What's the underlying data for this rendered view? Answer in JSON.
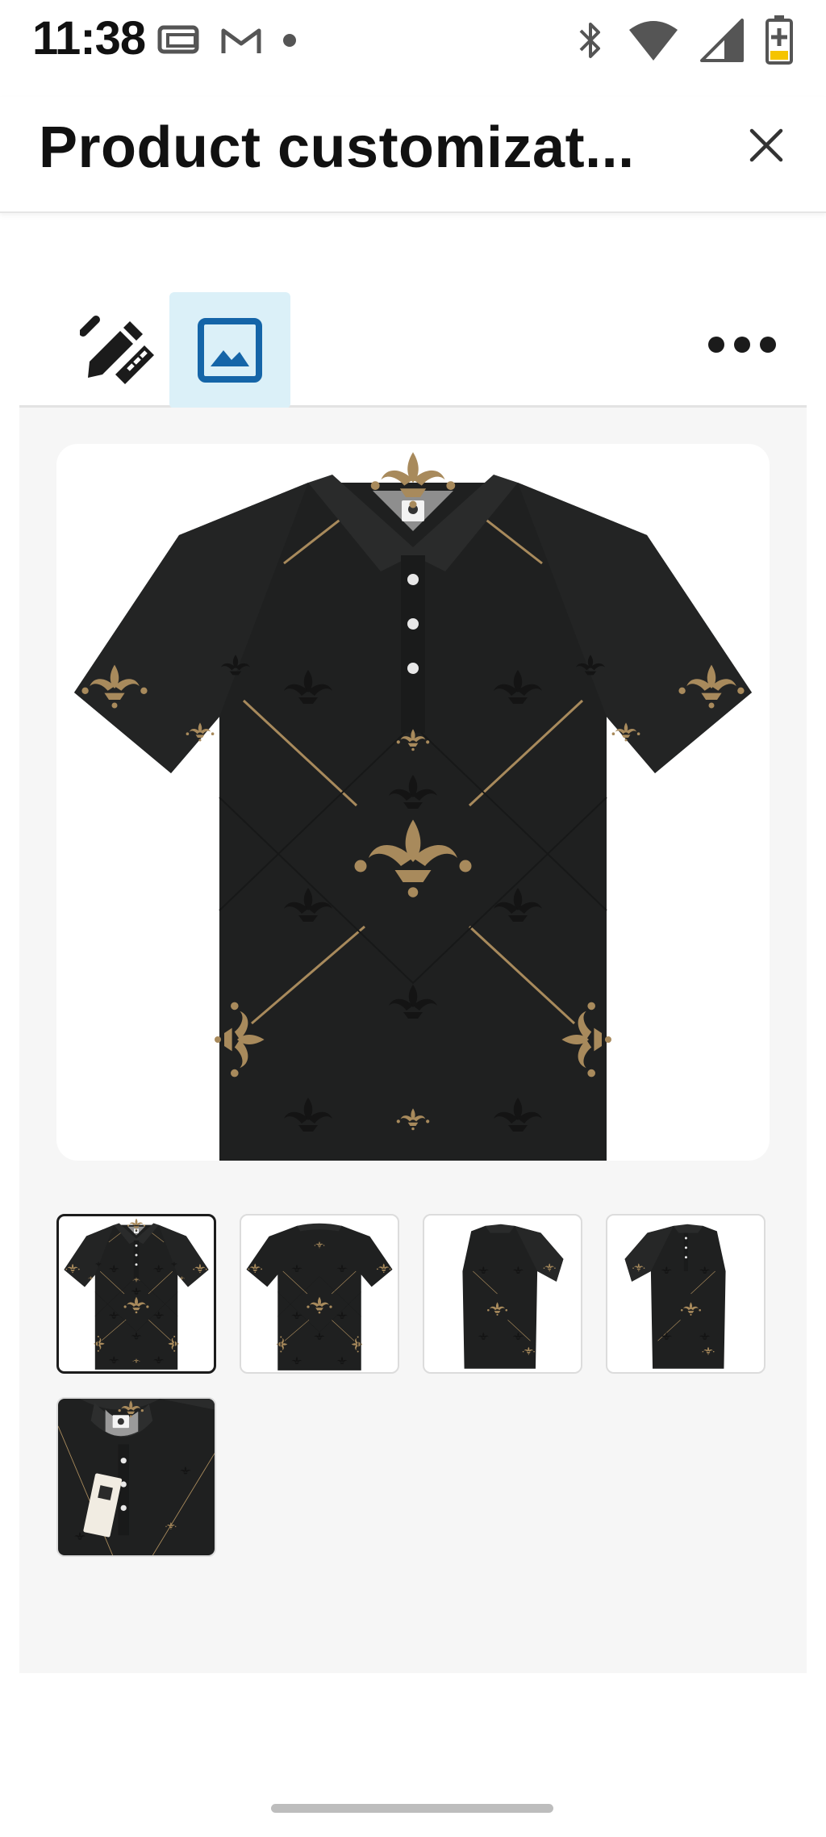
{
  "status_bar": {
    "time": "11:38",
    "left_icons": [
      "screen-cast-icon",
      "gmail-icon",
      "notification-dot-icon"
    ],
    "right_icons": [
      "bluetooth-icon",
      "wifi-icon",
      "cell-signal-icon",
      "battery-charging-icon"
    ]
  },
  "header": {
    "title": "Product customizat...",
    "close_icon": "close-icon"
  },
  "toolbar": {
    "tools": [
      {
        "icon": "design-tools-icon",
        "selected": false
      },
      {
        "icon": "image-icon",
        "selected": true
      }
    ],
    "more_icon": "more-horizontal-icon"
  },
  "gallery": {
    "main_view": "polo-front",
    "thumbnails": [
      {
        "view": "front",
        "selected": true
      },
      {
        "view": "back",
        "selected": false
      },
      {
        "view": "side-left",
        "selected": false
      },
      {
        "view": "side-right",
        "selected": false
      },
      {
        "view": "collar-detail",
        "selected": false
      }
    ]
  },
  "colors": {
    "accent_highlight": "#dbf0f8",
    "image_icon_blue": "#1565a8",
    "shirt_fabric": "#1f2020",
    "pattern_gold": "#a88a5c",
    "panel_background": "#f6f6f6"
  }
}
